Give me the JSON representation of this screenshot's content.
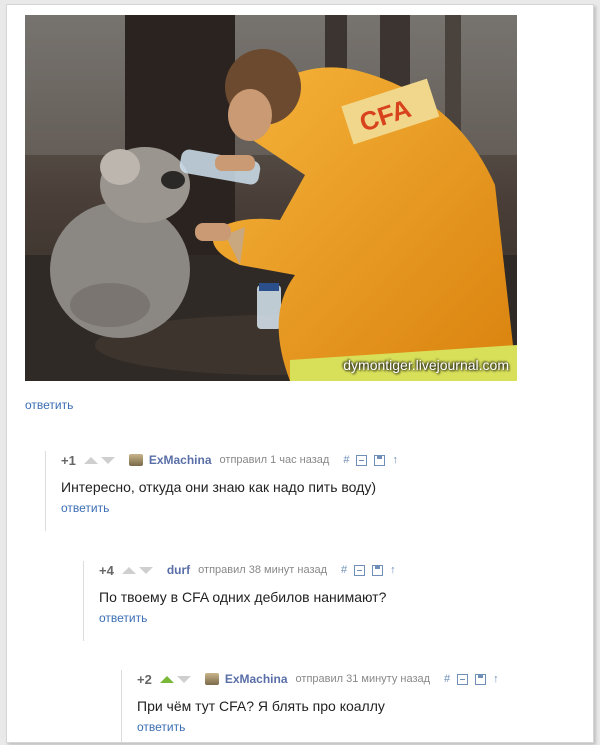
{
  "post": {
    "watermark": "dymontiger.livejournal.com",
    "reply_label": "ответить"
  },
  "comments": [
    {
      "rating": "+1",
      "author": "ExMachina",
      "meta": "отправил 1 час назад",
      "text": "Интересно, откуда они знаю как надо пить воду)",
      "reply_label": "ответить",
      "upvoted": false
    },
    {
      "rating": "+4",
      "author": "durf",
      "meta": "отправил 38 минут назад",
      "text": "По твоему в CFA одних дебилов нанимают?",
      "reply_label": "ответить",
      "upvoted": false
    },
    {
      "rating": "+2",
      "author": "ExMachina",
      "meta": "отправил 31 минуту назад",
      "text": "При чём тут CFA? Я блять про коаллу",
      "reply_label": "ответить",
      "upvoted": true
    }
  ],
  "tools": {
    "hash": "#",
    "up_arrow": "↑"
  },
  "colors": {
    "link": "#3a6db3",
    "upvote_active": "#7ab83a",
    "jacket": "#f0a21e"
  },
  "icons": [
    "koala-photo",
    "vote-up-icon",
    "vote-down-icon",
    "avatar-icon",
    "collapse-icon",
    "save-icon",
    "parent-arrow-icon"
  ]
}
